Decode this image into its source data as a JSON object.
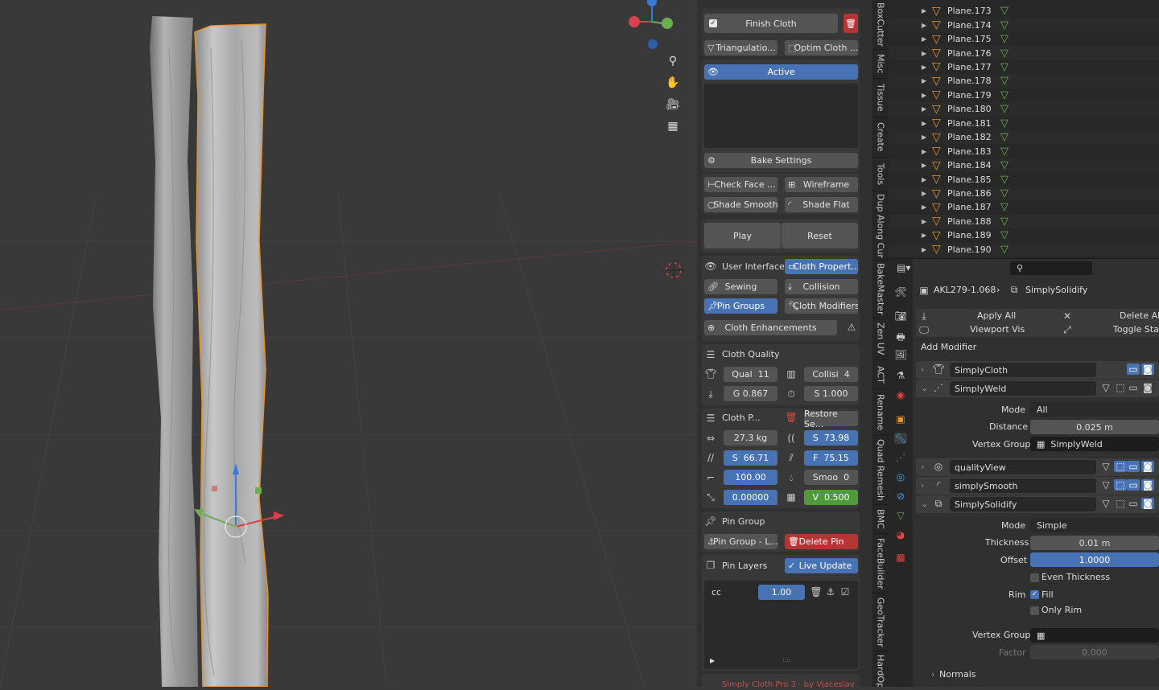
{
  "viewport": {
    "nav_icons": [
      "zoom-icon",
      "hand-pan-icon",
      "camera-icon",
      "grid-perspective-icon"
    ]
  },
  "npanel": {
    "finish_cloth": "Finish Cloth",
    "triangulation": "Triangulatio...",
    "optim_cloth": "Optim Cloth ...",
    "active": "Active",
    "bake_settings": "Bake Settings",
    "check_face": "Check Face ...",
    "wireframe": "Wireframe",
    "shade_smooth": "Shade Smooth",
    "shade_flat": "Shade Flat",
    "play": "Play",
    "reset": "Reset",
    "user_interface": "User Interface",
    "cloth_properties": "Cloth Propert...",
    "sewing": "Sewing",
    "collision": "Collision",
    "pin_groups": "Pin Groups",
    "cloth_modifiers": "Cloth Modifiers",
    "cloth_enhancements": "Cloth Enhancements",
    "cloth_quality": "Cloth Quality",
    "qual": "Qual",
    "qual_val": "11",
    "collisi": "Collisi",
    "collisi_val": "4",
    "g": "G",
    "g_val": "0.867",
    "s": "S",
    "s_val": "1.000",
    "cloth_p": "Cloth P...",
    "restore_se": "Restore Se...",
    "mass": "27.3 kg",
    "s2": "S",
    "s2_val": "73.98",
    "s3": "S",
    "s3_val": "66.71",
    "f": "F",
    "f_val": "75.15",
    "v100": "100.00",
    "smoo": "Smoo",
    "smoo_val": "0",
    "v_zero": "0.00000",
    "v": "V",
    "v_val": "0.500",
    "pin_group": "Pin Group",
    "pin_group_l": "Pin Group - L...",
    "delete_pin": "Delete Pin",
    "pin_layers": "Pin Layers",
    "live_update": "Live Update",
    "layer_name": "cc",
    "layer_val": "1.00",
    "footer": "Simply Cloth Pro 3 - by Vjaceslav"
  },
  "vtabs": [
    "BoxCutter",
    "Misc",
    "Tissue",
    "Create",
    "Tools",
    "Dup Along Cur",
    "BakeMaster",
    "Zen UV",
    "ACT",
    "Rename",
    "Quad Remesh",
    "BMC",
    "FaceBuilder",
    "GeoTracker",
    "HardOp"
  ],
  "outliner": {
    "items": [
      "Plane.173",
      "Plane.174",
      "Plane.175",
      "Plane.176",
      "Plane.177",
      "Plane.178",
      "Plane.179",
      "Plane.180",
      "Plane.181",
      "Plane.182",
      "Plane.183",
      "Plane.184",
      "Plane.185",
      "Plane.186",
      "Plane.187",
      "Plane.188",
      "Plane.189",
      "Plane.190"
    ]
  },
  "props": {
    "breadcrumb_object": "AKL279-1.068",
    "breadcrumb_modifier": "SimplySolidify",
    "apply_all": "Apply All",
    "delete_all": "Delete All",
    "viewport_vis": "Viewport Vis",
    "toggle_stack": "Toggle Stac",
    "add_modifier": "Add Modifier",
    "modifiers": [
      "SimplyCloth",
      "SimplyWeld",
      "qualityView",
      "simplySmooth",
      "SimplySolidify"
    ],
    "weld": {
      "mode_label": "Mode",
      "mode_val": "All",
      "distance_label": "Distance",
      "distance_val": "0.025 m",
      "vgroup_label": "Vertex Group",
      "vgroup_val": "SimplyWeld"
    },
    "solidify": {
      "mode_label": "Mode",
      "mode_val": "Simple",
      "thickness_label": "Thickness",
      "thickness_val": "0.01 m",
      "offset_label": "Offset",
      "offset_val": "1.0000",
      "even_thickness": "Even Thickness",
      "rim_label": "Rim",
      "fill": "Fill",
      "only_rim": "Only Rim",
      "vgroup_label": "Vertex Group",
      "factor_label": "Factor",
      "factor_val": "0.000",
      "normals": "Normals"
    }
  }
}
